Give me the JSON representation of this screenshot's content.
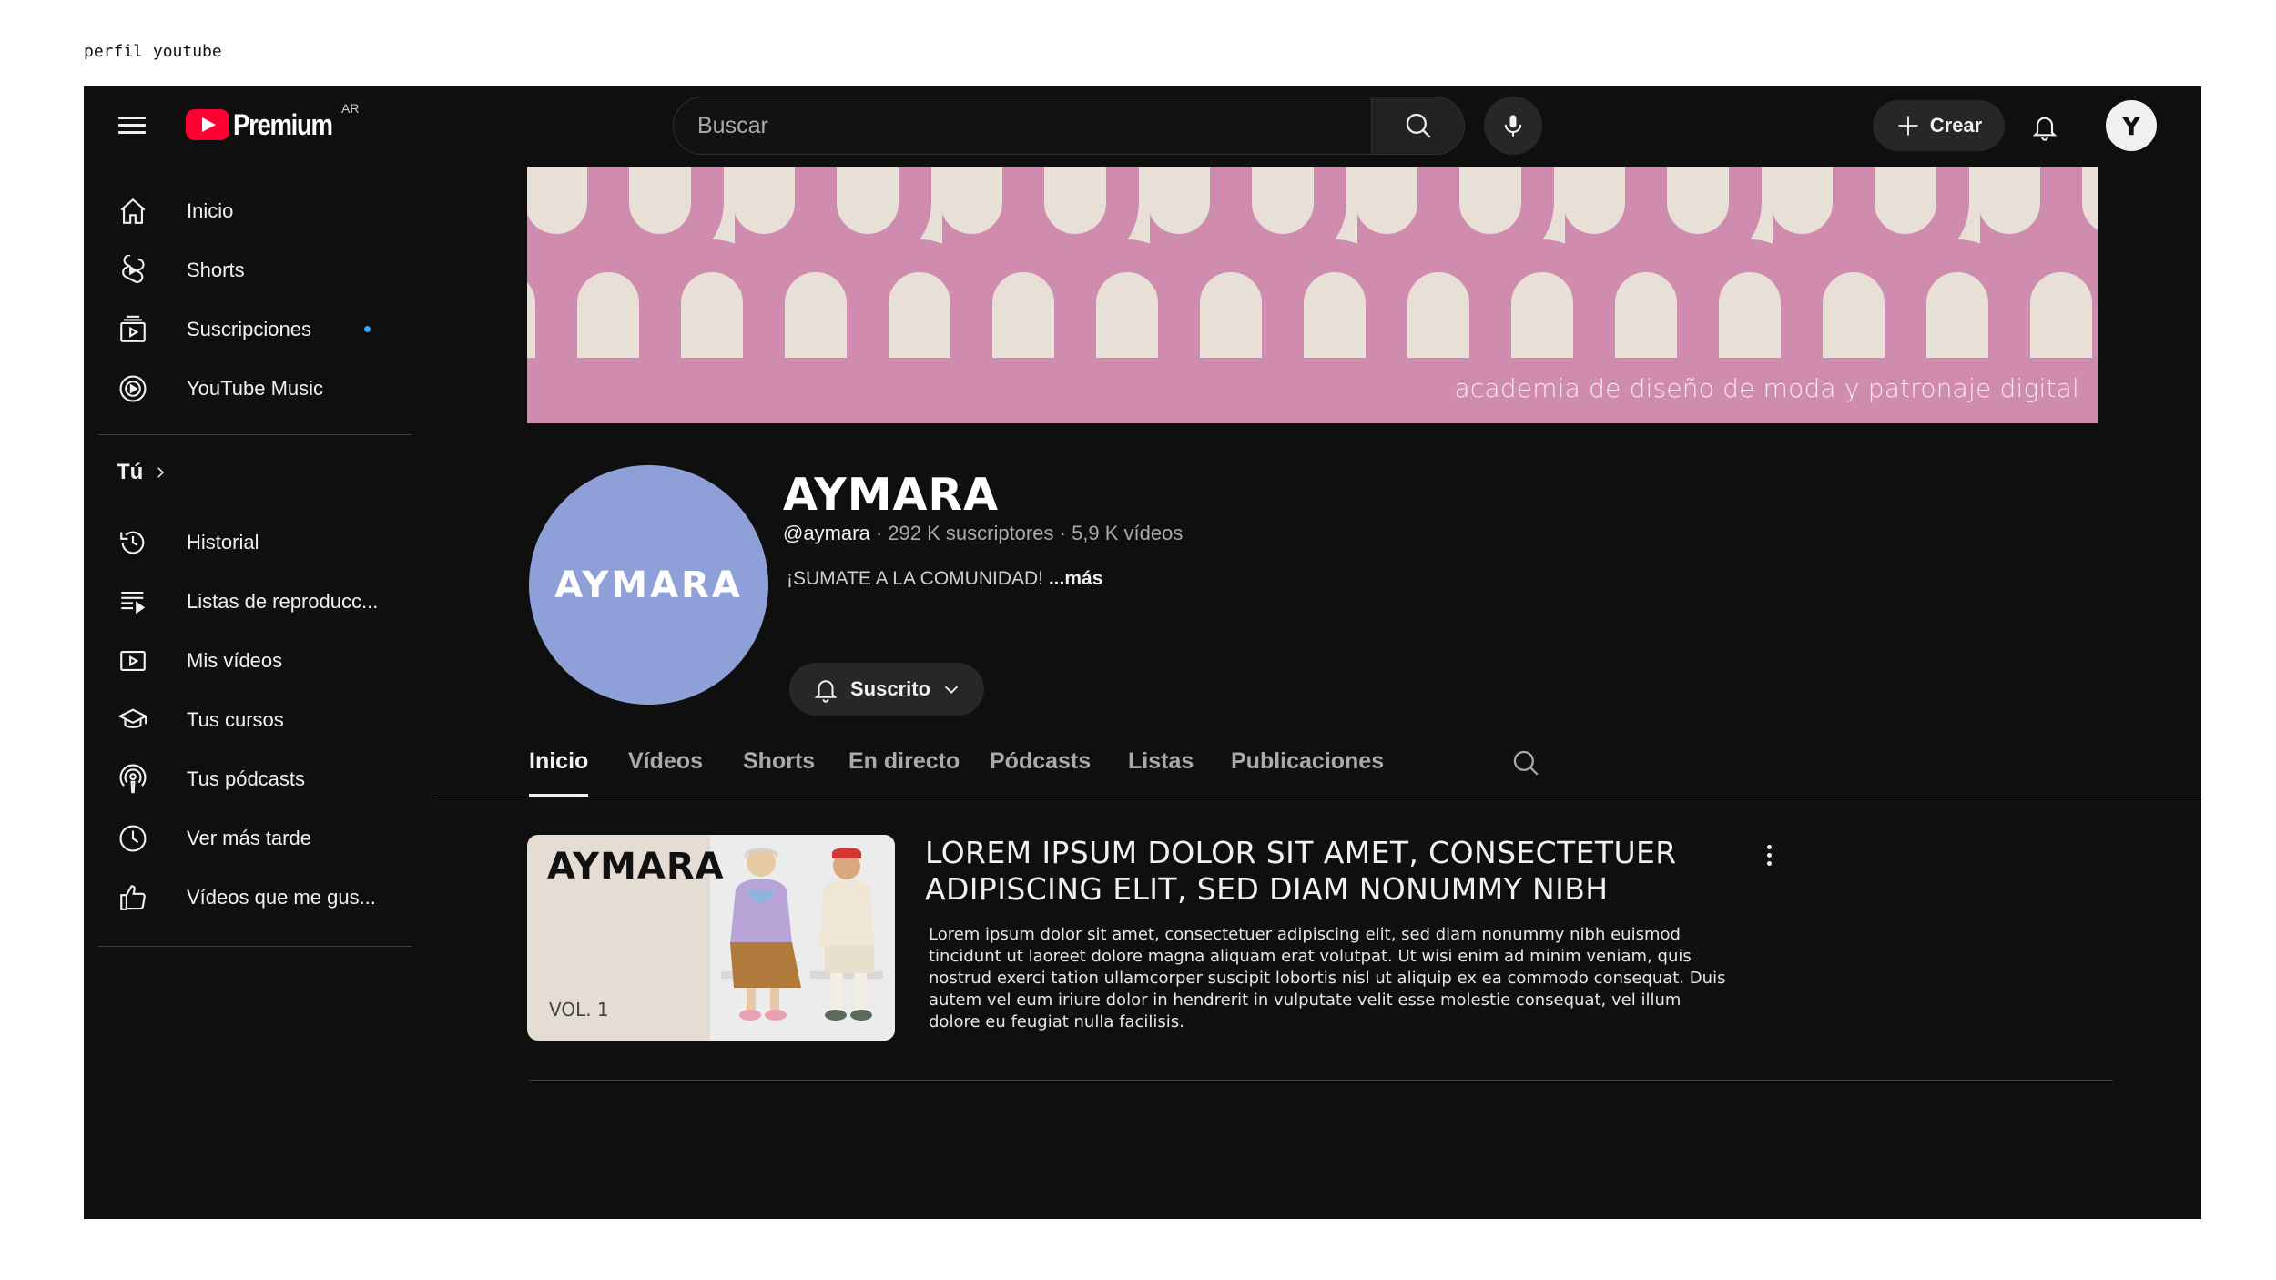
{
  "caption": "perfil youtube",
  "header": {
    "logo_text": "Premium",
    "country_code": "AR",
    "search_placeholder": "Buscar",
    "create_label": "Crear",
    "avatar_letter": "Y"
  },
  "sidebar": {
    "main_items": [
      {
        "label": "Inicio",
        "icon": "home-icon"
      },
      {
        "label": "Shorts",
        "icon": "shorts-icon"
      },
      {
        "label": "Suscripciones",
        "icon": "subscriptions-icon",
        "has_new": true
      },
      {
        "label": "YouTube Music",
        "icon": "youtube-music-icon"
      }
    ],
    "you_label": "Tú",
    "you_items": [
      {
        "label": "Historial",
        "icon": "history-icon"
      },
      {
        "label": "Listas de reproducc...",
        "icon": "playlists-icon"
      },
      {
        "label": "Mis vídeos",
        "icon": "my-videos-icon"
      },
      {
        "label": "Tus cursos",
        "icon": "courses-icon"
      },
      {
        "label": "Tus pódcasts",
        "icon": "podcasts-icon"
      },
      {
        "label": "Ver más tarde",
        "icon": "watch-later-icon"
      },
      {
        "label": "Vídeos que me gus...",
        "icon": "liked-videos-icon"
      }
    ]
  },
  "banner": {
    "tagline": "academia de diseño de moda y patronaje digital",
    "colors": {
      "pink": "#cf8cae",
      "cream": "#e8e0d6"
    }
  },
  "channel": {
    "avatar_text": "AYMARA",
    "avatar_color": "#8fa0d8",
    "name": "AYMARA",
    "handle": "@aymara",
    "subscribers": "292 K suscriptores",
    "videos": "5,9 K vídeos",
    "description": "¡SUMATE A LA COMUNIDAD!",
    "more_label": "...más",
    "subscribe_label": "Suscrito"
  },
  "tabs": [
    "Inicio",
    "Vídeos",
    "Shorts",
    "En directo",
    "Pódcasts",
    "Listas",
    "Publicaciones"
  ],
  "active_tab": "Inicio",
  "featured": {
    "thumb_title": "AYMARA",
    "thumb_vol": "VOL. 1",
    "title": "LOREM IPSUM DOLOR SIT AMET, CONSECTETUER ADIPISCING ELIT, SED DIAM NONUMMY NIBH",
    "description": "Lorem ipsum dolor sit amet, consectetuer adipiscing elit, sed diam nonummy nibh euismod tincidunt ut laoreet dolore magna aliquam erat volutpat. Ut wisi enim ad minim veniam, quis nostrud exerci tation ullamcorper suscipit lobortis nisl ut aliquip ex ea commodo consequat. Duis autem vel eum iriure dolor in hendrerit in vulputate velit esse molestie consequat, vel illum dolore eu feugiat nulla facilisis."
  },
  "colors": {
    "background": "#0f0f0f",
    "accent": "#ff0033",
    "badge_blue": "#3ea6ff"
  }
}
